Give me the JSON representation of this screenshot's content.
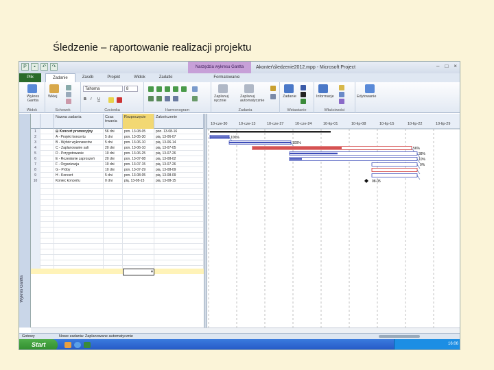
{
  "slide_title": "Śledzenie – raportowanie realizacji projektu",
  "window": {
    "context_tab": "Narzędzia wykresu Gantta",
    "title": "Akonter\\śledzenie2012.mpp - Microsoft Project",
    "controls": [
      "–",
      "□",
      "×"
    ]
  },
  "tabs": [
    {
      "label": "Plik"
    },
    {
      "label": "Zadanie"
    },
    {
      "label": "Zasób"
    },
    {
      "label": "Projekt"
    },
    {
      "label": "Widok"
    },
    {
      "label": "Zadatki"
    },
    {
      "label": "Formatowanie"
    }
  ],
  "ribbon": {
    "groups": [
      "Widok",
      "Schowek",
      "Czcionka",
      "Harmonogram",
      "Zadania",
      "Wstawianie",
      "Właściwości"
    ],
    "buttons": {
      "gantt": "Wykres Gantta",
      "paste": "Wklej",
      "manual": "Zaplanuj ręcznie",
      "auto": "Zaplanuj automatycznie",
      "task": "Zadanie",
      "info": "Informacje",
      "edit": "Edytowanie"
    },
    "font_name": "Tahoma",
    "font_size": "8"
  },
  "vertical_label": "Wykres Gantta",
  "grid": {
    "headers": {
      "name": "Nazwa zadania",
      "duration": "Czas trwania",
      "start": "Rozpoczęcie",
      "finish": "Zakończenie"
    },
    "rows": [
      {
        "num": "1",
        "name": "⊟ Koncert promocyjny",
        "duration": "56 dni",
        "start": "pon. 13-08-05",
        "finish": "pon. 13-08-16"
      },
      {
        "num": "2",
        "name": "A - Projekt koncertu",
        "duration": "5 dni",
        "start": "pon. 13-05-30",
        "finish": "pią. 13-06-07"
      },
      {
        "num": "3",
        "name": "B - Wybór wykonawców",
        "duration": "5 dni",
        "start": "pon. 13-06-10",
        "finish": "pią. 13-06-14"
      },
      {
        "num": "4",
        "name": "C - Zaplanowanie sali",
        "duration": "20 dni",
        "start": "pon. 13-06-10",
        "finish": "pią. 13-07-05"
      },
      {
        "num": "5",
        "name": "D - Przygotowanie",
        "duration": "10 dni",
        "start": "pon. 13-06-25",
        "finish": "pią. 13-07-26"
      },
      {
        "num": "6",
        "name": "E - Rozesłanie zaproszeń",
        "duration": "20 dni",
        "start": "pon. 13-07-08",
        "finish": "pią. 13-08-02"
      },
      {
        "num": "7",
        "name": "F - Organizacja",
        "duration": "10 dni",
        "start": "pon. 13-07-15",
        "finish": "pią. 13-07-26"
      },
      {
        "num": "8",
        "name": "G - Próby",
        "duration": "10 dni",
        "start": "pon. 13-07-29",
        "finish": "pią. 13-08-09"
      },
      {
        "num": "9",
        "name": "H - Koncert",
        "duration": "5 dni",
        "start": "pon. 13-08-05",
        "finish": "pią. 13-08-09"
      },
      {
        "num": "10",
        "name": "Koniec koncertu",
        "duration": "0 dni",
        "start": "pią. 13-08-15",
        "finish": "pią. 13-08-15"
      }
    ]
  },
  "gantt": {
    "dates": [
      "10-cze-30",
      "10-cze-13",
      "10-cze-27",
      "10-cze-24",
      "10-lip-01",
      "10-lip-08",
      "10-lip-15",
      "10-lip-22",
      "10-lip-29"
    ],
    "labels": [
      "100%",
      "100%",
      "56%",
      "38%",
      "10%",
      "0%",
      "08-05"
    ],
    "colors": {
      "bar_blue": "#3b4bb8",
      "bar_red": "#cc2b2b",
      "summary": "#222222"
    }
  },
  "status": {
    "ready": "Gotowy",
    "new_tasks": "Nowe zadania: Zaplanowane automatycznie"
  },
  "taskbar": {
    "start": "Start",
    "clock": "16:06"
  }
}
